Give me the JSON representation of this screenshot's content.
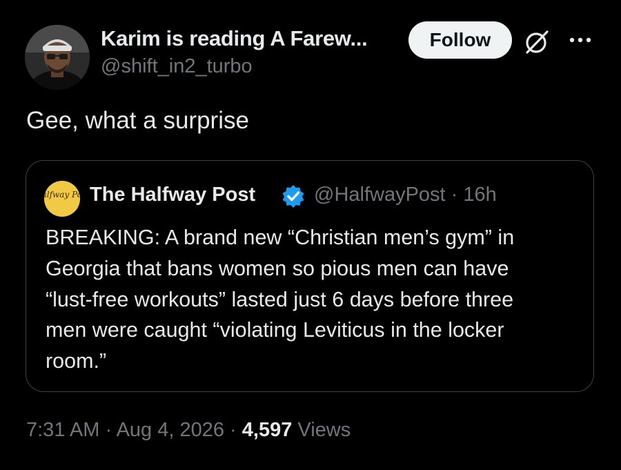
{
  "author": {
    "name": "Karim is reading A Farew...",
    "handle": "@shift_in2_turbo"
  },
  "header": {
    "follow_label": "Follow",
    "icons": [
      "grok-icon",
      "more-dots-icon"
    ]
  },
  "tweet": {
    "text": "Gee, what a surprise"
  },
  "quote": {
    "avatar_text": "Halfway Post",
    "name": "The Halfway Post",
    "handle_time": "@HalfwayPost · 16h",
    "verified_color": "#1d9bf0",
    "lines": [
      "BREAKING: A brand new “Christian men’s gym” in",
      "Georgia that bans women so pious men can have",
      "“lust-free workouts” lasted just 6 days before three",
      "men were caught “violating Leviticus in the locker",
      "room.”"
    ]
  },
  "footer": {
    "timestamp": "7:31 AM · Aug 4, 2026 · ",
    "views_count": "4,597",
    "views_label": " Views"
  },
  "colors": {
    "background": "#000000",
    "text": "#e7e9ea",
    "muted": "#71767b",
    "border": "#3e4144",
    "follow_bg": "#eff3f4"
  }
}
